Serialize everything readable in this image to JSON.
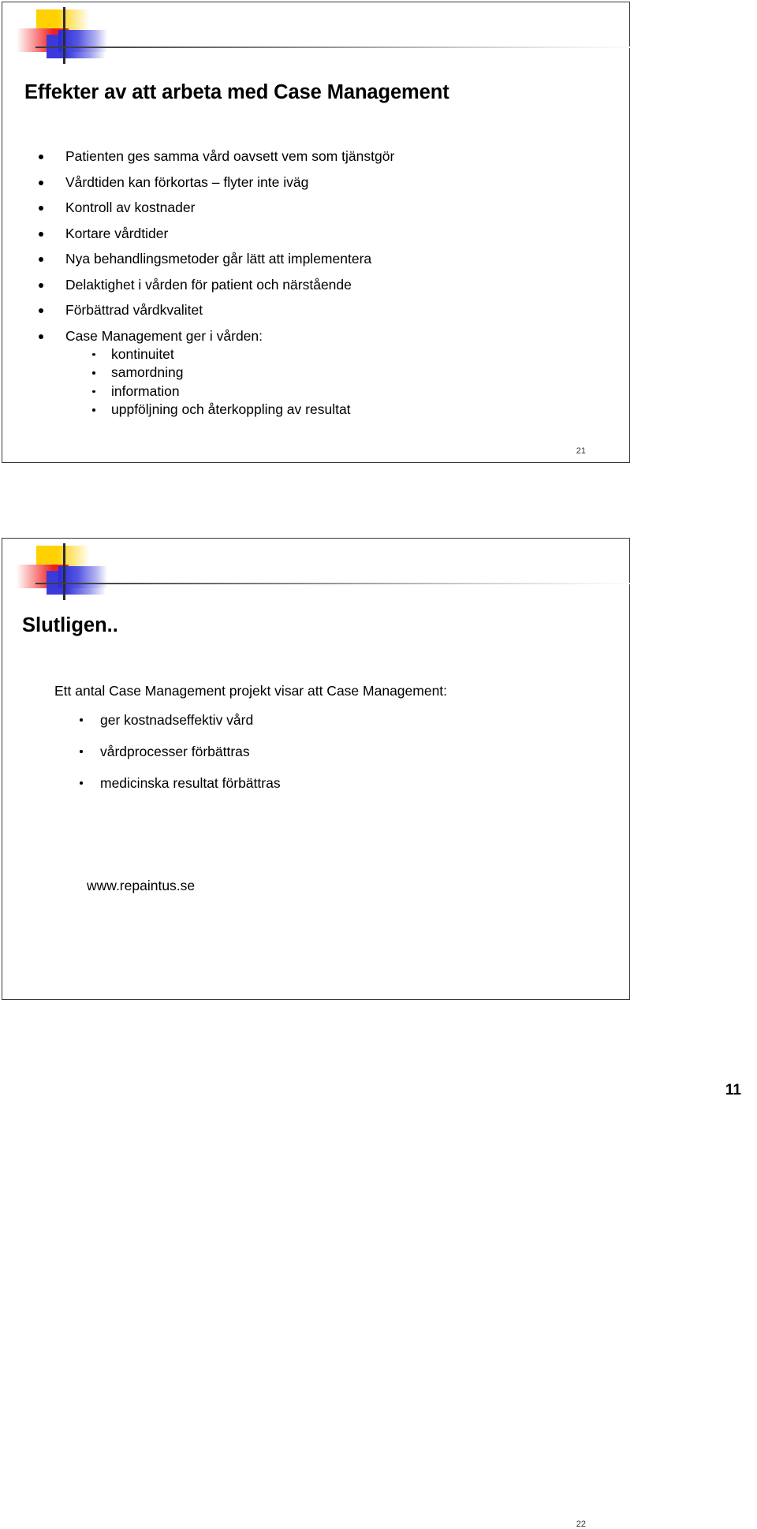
{
  "page": {
    "page_number": "11"
  },
  "slides": [
    {
      "number": "21",
      "title": "Effekter av att arbeta med Case Management",
      "bullets": [
        "Patienten ges samma vård oavsett vem som tjänstgör",
        "Vårdtiden kan förkortas – flyter inte iväg",
        "Kontroll av kostnader",
        "Kortare vårdtider",
        "Nya behandlingsmetoder går lätt att implementera",
        "Delaktighet i vården för patient och närstående",
        "Förbättrad vårdkvalitet",
        "Case Management ger i vården:"
      ],
      "subbullets": [
        "kontinuitet",
        "samordning",
        "information",
        "uppföljning och återkoppling av resultat"
      ]
    },
    {
      "number": "22",
      "title": "Slutligen..",
      "intro": "Ett antal Case Management projekt visar att Case Management:",
      "subbullets": [
        "ger kostnadseffektiv vård",
        "vårdprocesser förbättras",
        "medicinska resultat förbättras"
      ],
      "website": "www.repaintus.se"
    }
  ]
}
